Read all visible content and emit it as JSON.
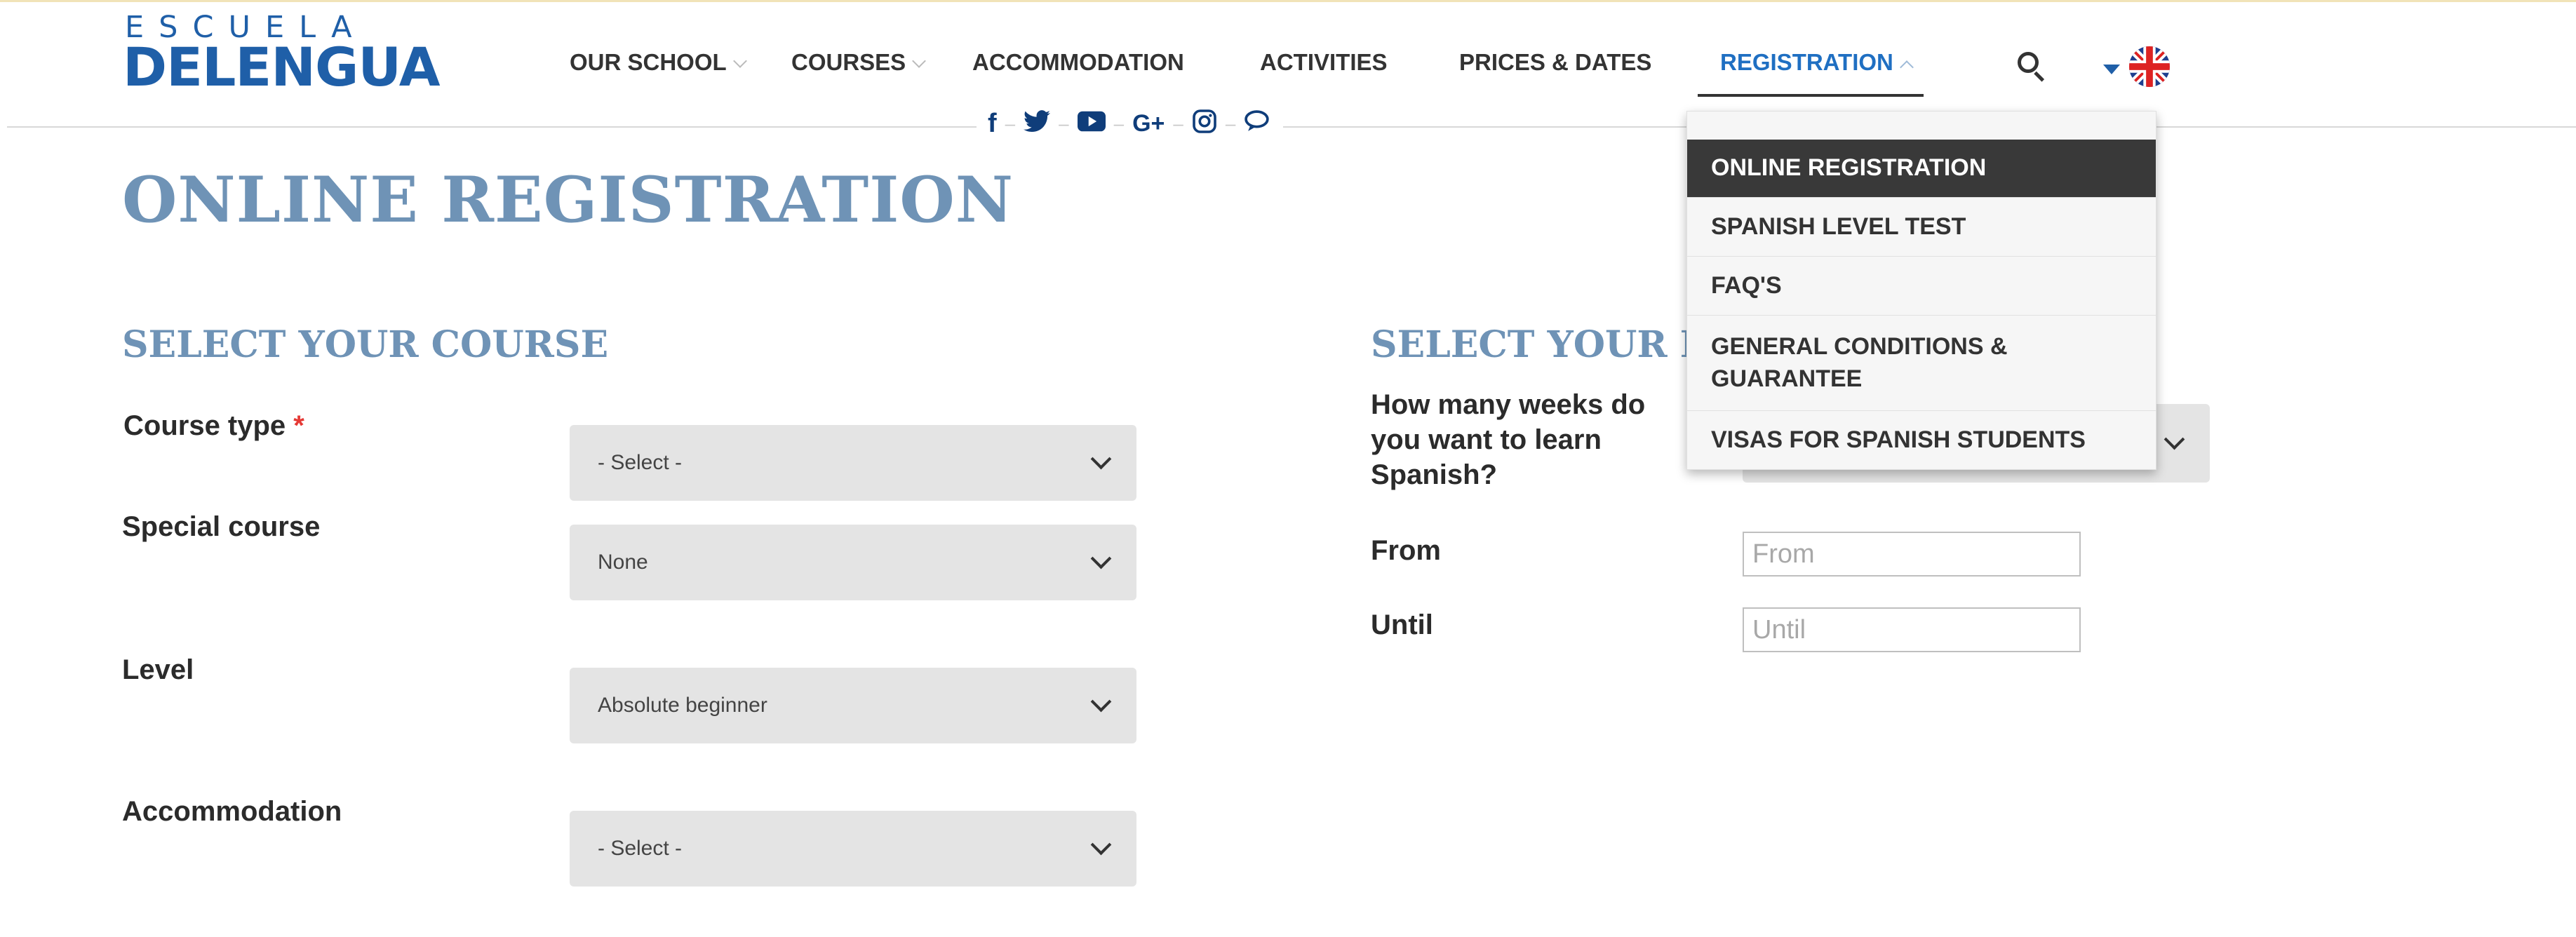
{
  "brand": {
    "logo_top": "ESCUELA",
    "logo_main": "DELENGUA",
    "color": "#1f5fa8"
  },
  "nav": {
    "items": [
      {
        "label": "OUR SCHOOL",
        "has_dropdown": true
      },
      {
        "label": "COURSES",
        "has_dropdown": true
      },
      {
        "label": "ACCOMMODATION",
        "has_dropdown": false
      },
      {
        "label": "ACTIVITIES",
        "has_dropdown": false
      },
      {
        "label": "PRICES & DATES",
        "has_dropdown": false
      },
      {
        "label": "REGISTRATION",
        "has_dropdown": true,
        "active": true
      }
    ],
    "search_icon": "search-icon",
    "language_icon": "uk-flag-icon",
    "active_color": "#1f6fc2"
  },
  "social": {
    "icons": [
      {
        "name": "facebook-icon",
        "glyph": "f"
      },
      {
        "name": "twitter-icon",
        "glyph": "🐦"
      },
      {
        "name": "youtube-icon",
        "glyph": "▶"
      },
      {
        "name": "google-plus-icon",
        "glyph": "G+"
      },
      {
        "name": "instagram-icon",
        "glyph": "◎"
      },
      {
        "name": "chat-icon",
        "glyph": "💬"
      }
    ]
  },
  "dropdown": {
    "items": [
      {
        "label": "ONLINE REGISTRATION",
        "selected": true
      },
      {
        "label": "SPANISH LEVEL TEST"
      },
      {
        "label": "FAQ'S"
      },
      {
        "label": "GENERAL CONDITIONS & GUARANTEE"
      },
      {
        "label": "VISAS FOR SPANISH STUDENTS"
      }
    ]
  },
  "page": {
    "title": "ONLINE REGISTRATION"
  },
  "course": {
    "heading": "SELECT YOUR COURSE",
    "course_type_label": "Course type",
    "required_mark": "*",
    "course_type_value": "- Select -",
    "special_label": "Special course",
    "special_value": "None",
    "level_label": "Level",
    "level_value": "Absolute beginner",
    "accommodation_label": "Accommodation",
    "accommodation_value": "- Select -"
  },
  "dates": {
    "heading": "SELECT YOUR DA",
    "weeks_label": "How many weeks do you want to learn Spanish?",
    "from_label": "From",
    "from_placeholder": "From",
    "until_label": "Until",
    "until_placeholder": "Until"
  }
}
